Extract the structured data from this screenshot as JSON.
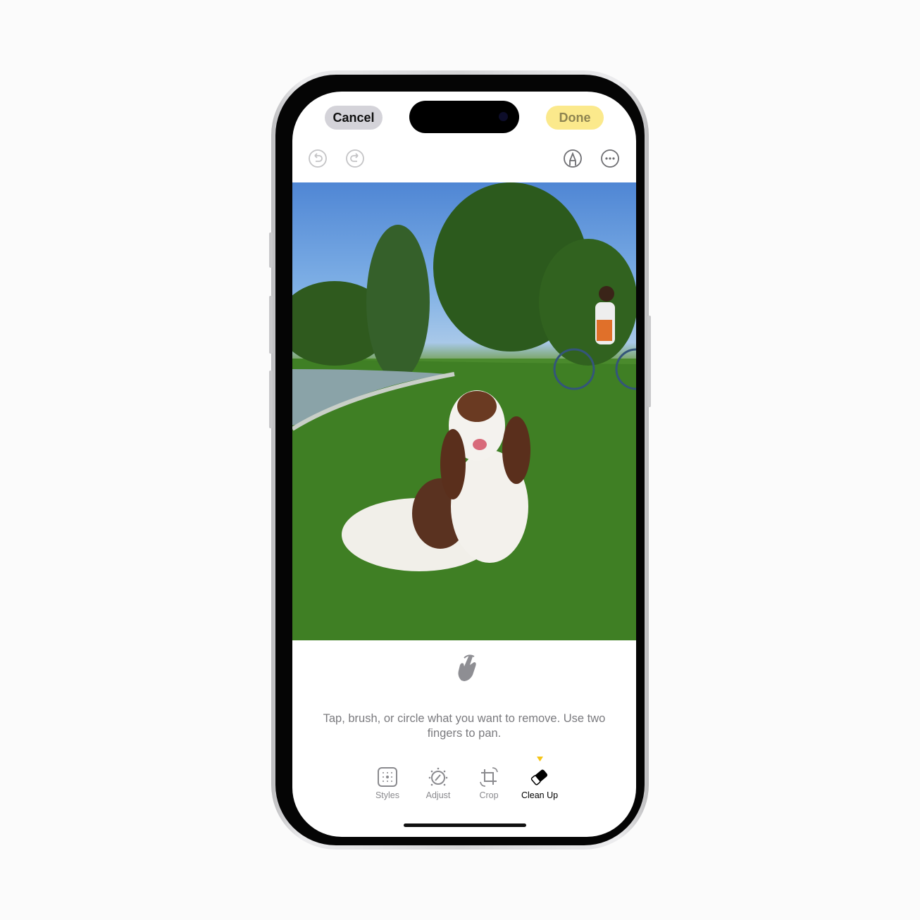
{
  "header": {
    "cancel_label": "Cancel",
    "done_label": "Done"
  },
  "toolbar": {
    "icons": [
      "undo-icon",
      "redo-icon",
      "markup-icon",
      "more-icon"
    ]
  },
  "hint": {
    "icon": "hand-gesture-icon",
    "text": "Tap, brush, or circle what you want to remove. Use two fingers to pan."
  },
  "tabs": [
    {
      "label": "Styles",
      "icon": "styles-icon"
    },
    {
      "label": "Adjust",
      "icon": "adjust-icon"
    },
    {
      "label": "Crop",
      "icon": "crop-icon"
    },
    {
      "label": "Clean Up",
      "icon": "eraser-icon",
      "selected": true
    }
  ],
  "colors": {
    "accent": "#f5c518",
    "done_bg": "#fbe98c",
    "cancel_bg": "#d4d3d9"
  }
}
